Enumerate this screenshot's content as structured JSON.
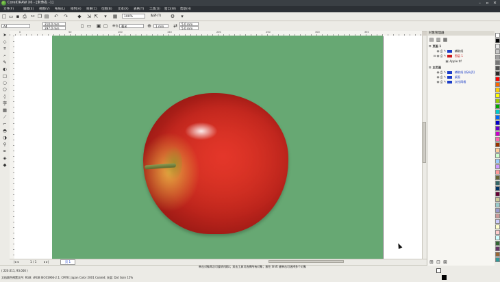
{
  "window": {
    "title": "CorelDRAW X6 - [未命名 -1]",
    "controls": [
      "–",
      "▫",
      "✕"
    ]
  },
  "menu": [
    "文件(F)",
    "编辑(E)",
    "视图(V)",
    "布局(L)",
    "排列(A)",
    "效果(C)",
    "位图(B)",
    "文本(X)",
    "表格(T)",
    "工具(O)",
    "窗口(W)",
    "帮助(H)"
  ],
  "toolbar": {
    "zoom": "100%",
    "snap": "贴齐(T)"
  },
  "propbar": {
    "page_size": "A4",
    "width": "210.0 mm",
    "height": "297.0 mm",
    "units": "毫米",
    "nudge": "1 mm",
    "dup_x": "5.0 mm",
    "dup_y": "5.0 mm"
  },
  "ruler": {
    "h_ticks": [
      "0",
      "50",
      "100",
      "150",
      "200",
      "250",
      "300",
      "350"
    ]
  },
  "pagebar": {
    "page_count": "1 / 1",
    "page_tab": "页 1"
  },
  "status": {
    "coords": "( 220.011, 93.000 )",
    "profile": "文档颜色预置文件: RGB: sRGB IEC61966-2.1; CMYK: Japan Color 2001 Coated; 灰度: Dot Gain 15%",
    "hint": "单击对象两次可旋转/倾斜；双击工具可选择所有对象；按住 Shift 键单击可选择多个对象"
  },
  "docker": {
    "title": "对象管理器",
    "rows": [
      {
        "label": "页面 1",
        "color": ""
      },
      {
        "label": "辅助线",
        "color": "#1a3cc8"
      },
      {
        "label": "图层 1",
        "color": "#cc1a1a"
      },
      {
        "label": "Apple.tif",
        "color": ""
      },
      {
        "label": "主页面",
        "color": ""
      },
      {
        "label": "辅助线 (所有页)",
        "color": "#1a3cc8"
      },
      {
        "label": "桌面",
        "color": "#1a3cc8"
      },
      {
        "label": "文档网格",
        "color": "#1a3cc8"
      }
    ]
  },
  "palette": [
    "#ffffff",
    "#000000",
    "#e8e8e8",
    "#c8c8c8",
    "#a0a0a0",
    "#787878",
    "#505050",
    "#2a2a2a",
    "#ff0000",
    "#ff6600",
    "#ffcc00",
    "#ffff00",
    "#99cc00",
    "#00aa00",
    "#00cccc",
    "#0066ff",
    "#0000cc",
    "#6600cc",
    "#cc00cc",
    "#ff66aa",
    "#993300",
    "#ffcc99",
    "#ccffcc",
    "#99ccff",
    "#cc99ff",
    "#ff9999",
    "#666633",
    "#336666",
    "#003366",
    "#660033",
    "#cccc99",
    "#99cccc",
    "#9999cc",
    "#cc9999",
    "#ccccff",
    "#ffffcc",
    "#ffcccc",
    "#ccffff",
    "#336633",
    "#663366",
    "#996633",
    "#339999"
  ],
  "colors": {
    "page_bg": "#67a873",
    "menu_bg": "#2c3035",
    "title_bg": "#3a3f44"
  }
}
